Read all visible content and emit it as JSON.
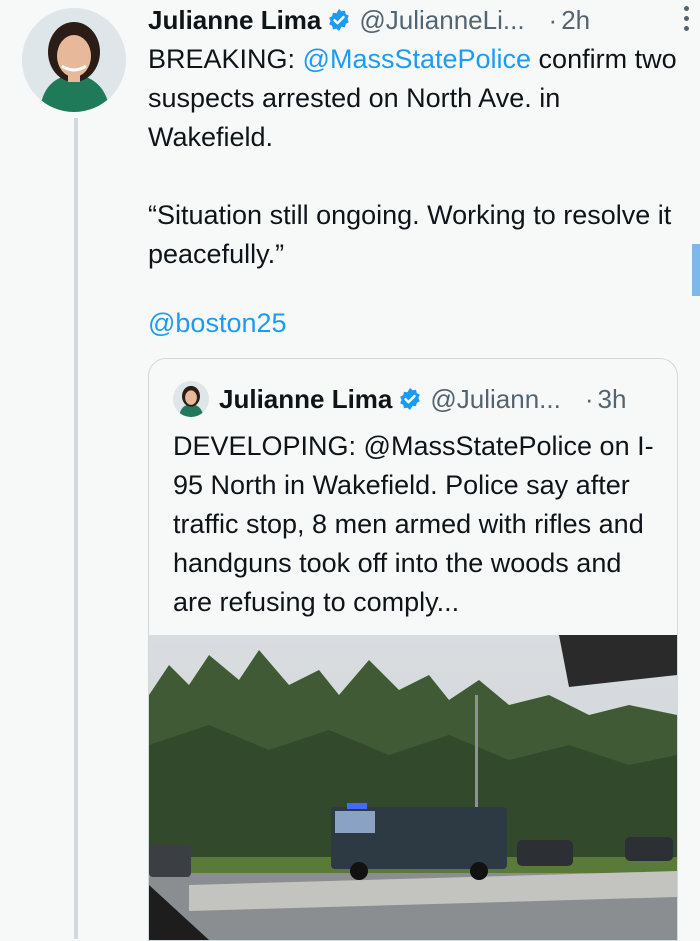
{
  "tweet": {
    "author_name": "Julianne Lima",
    "handle": "@JulianneLi...",
    "separator": "·",
    "time": "2h",
    "text_prefix": "BREAKING: ",
    "mention": "@MassStatePolice",
    "text_rest": " confirm two suspects arrested on North Ave. in Wakefield.\n\n“Situation still ongoing. Working to resolve it peacefully.”",
    "link": "@boston25"
  },
  "quoted_tweet": {
    "author_name": "Julianne Lima",
    "handle": "@Juliann...",
    "separator": "·",
    "time": "3h",
    "text": "DEVELOPING: @MassStatePolice on I-95 North in Wakefield. Police say after traffic stop, 8 men armed with rifles and handguns took off into the woods and are refusing to comply...",
    "image_alt": "Police command vehicle parked beside a highway next to trees"
  },
  "colors": {
    "accent": "#1d9bf0",
    "text": "#0f1419",
    "muted": "#536471",
    "border": "#cfd9de"
  },
  "icons": [
    "verified-badge-icon",
    "more-options-icon"
  ]
}
